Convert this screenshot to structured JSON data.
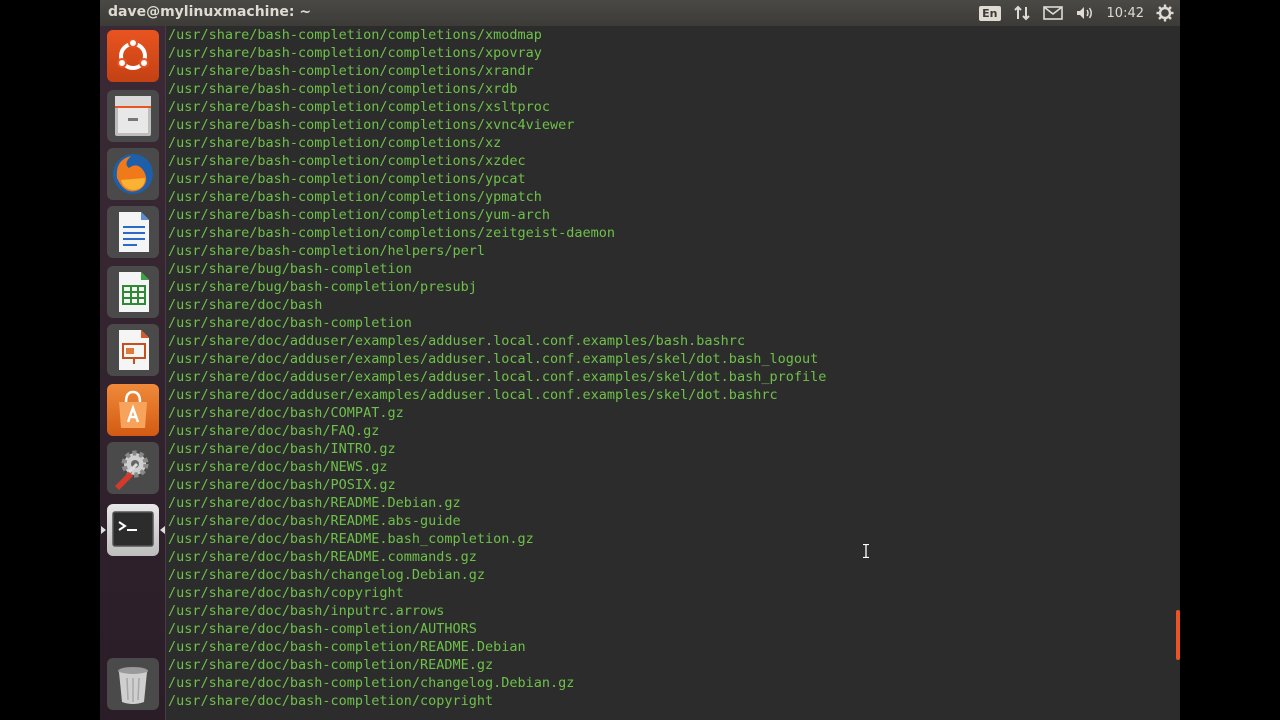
{
  "window": {
    "title": "dave@mylinuxmachine: ~"
  },
  "indicators": {
    "keyboard": "En",
    "clock": "10:42"
  },
  "launcher": {
    "items": [
      {
        "name": "dash-home",
        "icon": "ubuntu-logo-icon"
      },
      {
        "name": "files",
        "icon": "file-cabinet-icon"
      },
      {
        "name": "firefox",
        "icon": "firefox-icon"
      },
      {
        "name": "libreoffice-writer",
        "icon": "writer-document-icon"
      },
      {
        "name": "libreoffice-calc",
        "icon": "calc-spreadsheet-icon"
      },
      {
        "name": "libreoffice-impress",
        "icon": "impress-presentation-icon"
      },
      {
        "name": "software-center",
        "icon": "shopping-bag-icon"
      },
      {
        "name": "system-settings",
        "icon": "settings-gear-icon"
      },
      {
        "name": "terminal",
        "icon": "terminal-icon",
        "active": true
      },
      {
        "name": "trash",
        "icon": "trash-icon"
      }
    ]
  },
  "terminal": {
    "lines": [
      "/usr/share/bash-completion/completions/xmodmap",
      "/usr/share/bash-completion/completions/xpovray",
      "/usr/share/bash-completion/completions/xrandr",
      "/usr/share/bash-completion/completions/xrdb",
      "/usr/share/bash-completion/completions/xsltproc",
      "/usr/share/bash-completion/completions/xvnc4viewer",
      "/usr/share/bash-completion/completions/xz",
      "/usr/share/bash-completion/completions/xzdec",
      "/usr/share/bash-completion/completions/ypcat",
      "/usr/share/bash-completion/completions/ypmatch",
      "/usr/share/bash-completion/completions/yum-arch",
      "/usr/share/bash-completion/completions/zeitgeist-daemon",
      "/usr/share/bash-completion/helpers/perl",
      "/usr/share/bug/bash-completion",
      "/usr/share/bug/bash-completion/presubj",
      "/usr/share/doc/bash",
      "/usr/share/doc/bash-completion",
      "/usr/share/doc/adduser/examples/adduser.local.conf.examples/bash.bashrc",
      "/usr/share/doc/adduser/examples/adduser.local.conf.examples/skel/dot.bash_logout",
      "/usr/share/doc/adduser/examples/adduser.local.conf.examples/skel/dot.bash_profile",
      "/usr/share/doc/adduser/examples/adduser.local.conf.examples/skel/dot.bashrc",
      "/usr/share/doc/bash/COMPAT.gz",
      "/usr/share/doc/bash/FAQ.gz",
      "/usr/share/doc/bash/INTRO.gz",
      "/usr/share/doc/bash/NEWS.gz",
      "/usr/share/doc/bash/POSIX.gz",
      "/usr/share/doc/bash/README.Debian.gz",
      "/usr/share/doc/bash/README.abs-guide",
      "/usr/share/doc/bash/README.bash_completion.gz",
      "/usr/share/doc/bash/README.commands.gz",
      "/usr/share/doc/bash/changelog.Debian.gz",
      "/usr/share/doc/bash/copyright",
      "/usr/share/doc/bash/inputrc.arrows",
      "/usr/share/doc/bash-completion/AUTHORS",
      "/usr/share/doc/bash-completion/README.Debian",
      "/usr/share/doc/bash-completion/README.gz",
      "/usr/share/doc/bash-completion/changelog.Debian.gz",
      "/usr/share/doc/bash-completion/copyright"
    ]
  },
  "colors": {
    "terminal_text": "#6ec04a",
    "terminal_bg": "#2c2c2c",
    "accent": "#e95420"
  }
}
